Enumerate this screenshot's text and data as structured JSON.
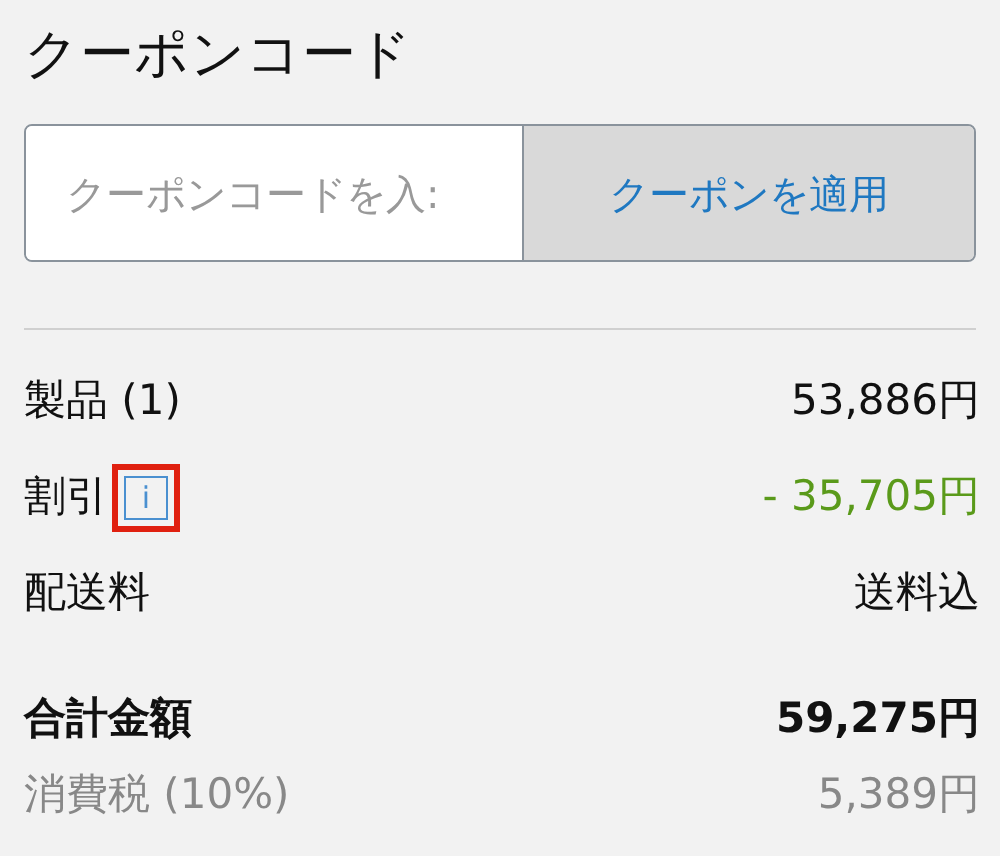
{
  "title": "クーポンコード",
  "coupon": {
    "placeholder": "クーポンコードを入:",
    "button": "クーポンを適用"
  },
  "summary": [
    {
      "kind": "normal",
      "label": "製品 (1)",
      "value": "53,886円"
    },
    {
      "kind": "discount",
      "label": "割引",
      "info": {
        "text": "i",
        "highlighted": true
      },
      "value": "- 35,705円"
    },
    {
      "kind": "normal",
      "label": "配送料",
      "value": "送料込"
    },
    {
      "kind": "total",
      "label": "合計金額",
      "value": "59,275円"
    },
    {
      "kind": "tax",
      "label": "消費税 (10%)",
      "value": "5,389円"
    }
  ]
}
